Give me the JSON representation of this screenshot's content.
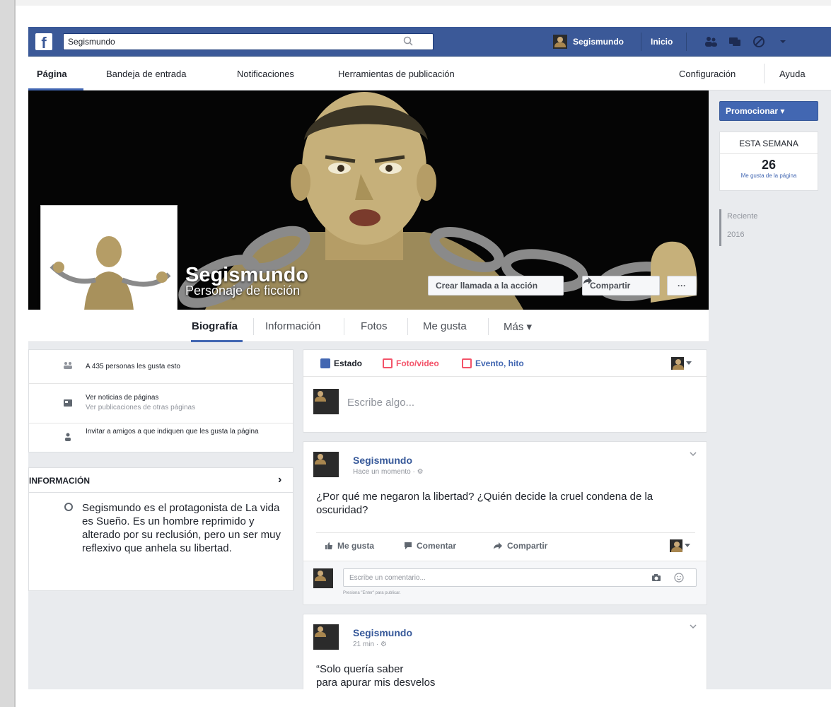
{
  "topbar": {
    "logo": "f",
    "search_value": "Segismundo",
    "user_name": "Segismundo",
    "home_label": "Inicio",
    "color": "#3b5998"
  },
  "page_nav": {
    "items": [
      "Página",
      "Bandeja de entrada",
      "Notificaciones",
      "Herramientas de publicación"
    ],
    "right": [
      "Configuración",
      "Ayuda"
    ]
  },
  "cover": {
    "name": "Segismundo",
    "category": "Personaje de ficción",
    "cta_label": "Crear llamada a la acción",
    "share_label": "Compartir",
    "more_label": "···"
  },
  "timeline_tabs": [
    "Biografía",
    "Información",
    "Fotos",
    "Me gusta",
    "Más ▾"
  ],
  "left": {
    "likes_text": "A 435 personas les gusta esto",
    "feed_title": "Ver noticias de páginas",
    "feed_sub": "Ver publicaciones de otras páginas",
    "invite_text": "Invitar a amigos a que indiquen que les gusta la página",
    "info_title": "INFORMACIÓN",
    "info_arrow": "›",
    "info_body": "Segismundo es el protagonista de La vida es Sueño. Es un hombre reprimido y alterado por su reclusión, pero un ser muy reflexivo que anhela su libertad."
  },
  "composer": {
    "tabs": [
      "Estado",
      "Foto/video",
      "Evento, hito"
    ],
    "placeholder": "Escribe algo..."
  },
  "posts": [
    {
      "author": "Segismundo",
      "time": "Hace un momento · ⚙",
      "text": "¿Por qué me negaron la libertad? ¿Quién decide la cruel condena de la oscuridad?",
      "actions": [
        "Me gusta",
        "Comentar",
        "Compartir"
      ],
      "comment_placeholder": "Escribe un comentario...",
      "comment_hint": "Presiona \"Enter\" para publicar."
    },
    {
      "author": "Segismundo",
      "time": "21 min · ⚙",
      "text_line1": "“Solo quería saber",
      "text_line2": "para apurar mis desvelos"
    }
  ],
  "right": {
    "promote_label": "Promocionar ▾",
    "week_title": "ESTA SEMANA",
    "week_count": "26",
    "week_label": "Me gusta de la página",
    "years": [
      "Reciente",
      "2016"
    ]
  }
}
